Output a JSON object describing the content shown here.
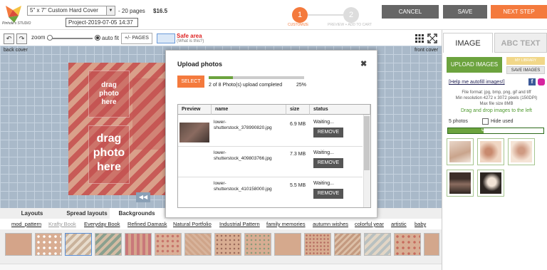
{
  "header": {
    "logo_text": "Pinhole's STUDIO",
    "product": "5\" x 7\" Custom Hard Cover",
    "pages": "- 20 pages",
    "price": "$16.5",
    "project_name": "Project-2019-07-05 14:37",
    "steps": [
      {
        "number": "1",
        "label": "CUSTOMIZE"
      },
      {
        "number": "2",
        "label": "PREVIEW + ADD TO CART"
      }
    ],
    "buttons": {
      "cancel": "CANCEL",
      "save": "SAVE",
      "next": "NEXT STEP"
    }
  },
  "toolbar": {
    "zoom_label": "zoom",
    "autofit_label": "auto fit",
    "pages_button": "+/- PAGES",
    "safe_area_title": "Safe area",
    "safe_area_sub": "(What is this?)"
  },
  "canvas": {
    "back_cover": "back cover",
    "front_cover": "front cover",
    "placeholder_text": [
      "drag",
      "photo",
      "here"
    ]
  },
  "bottom": {
    "tabs": [
      "Layouts",
      "Spread layouts",
      "Backgrounds"
    ],
    "active_tab": "Backgrounds",
    "categories": [
      "mod_pattern",
      "Krafty Book",
      "Everyday Book",
      "Refined Damask",
      "Natural Portfolio",
      "Industrial Pattern",
      "family memories",
      "autumn wishes",
      "colorful year",
      "artistic",
      "baby"
    ]
  },
  "right_panel": {
    "tab_image": "IMAGE",
    "tab_text": "ABC TEXT",
    "upload_button": "UPLOAD IMAGES",
    "library_button": "MY LIBRARY",
    "save_images_button": "SAVE IMAGES",
    "help_link": "[Help me autofill images!]",
    "info_lines": [
      "File format: jpg, bmp, png, gif and tiff",
      "Min resolution 4272 x 3072 pixels (150DPI)",
      "Max file size 8MB"
    ],
    "drag_info": "Drag and drop images to the left",
    "photo_count": "5 photos",
    "hide_used": "Hide used",
    "uploading_label": "Uploading [3/8]",
    "uploading_fraction": 0.375
  },
  "modal": {
    "title": "Upload photos",
    "select_button": "SELECT",
    "progress_text": "2 of 8 Photo(s) upload completed",
    "progress_percent": "25%",
    "progress_fraction": 0.25,
    "columns": [
      "Preview",
      "name",
      "size",
      "status"
    ],
    "rows": [
      {
        "name_line1": "lower-",
        "name_line2": "shutterstock_378990820.jpg",
        "size": "6.9 MB",
        "status": "Waiting...",
        "action": "REMOVE"
      },
      {
        "name_line1": "lower-",
        "name_line2": "shutterstock_409803766.jpg",
        "size": "7.3 MB",
        "status": "Waiting...",
        "action": "REMOVE"
      },
      {
        "name_line1": "lower-",
        "name_line2": "shutterstock_410158000.jpg",
        "size": "5.5 MB",
        "status": "Waiting...",
        "action": "REMOVE"
      }
    ]
  }
}
